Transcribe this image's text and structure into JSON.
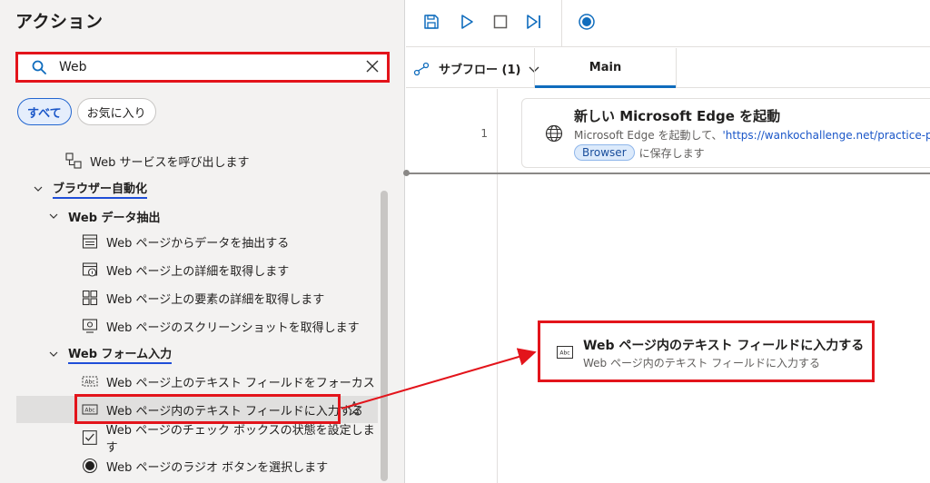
{
  "actions_pane": {
    "title": "アクション",
    "search": {
      "value": "Web"
    },
    "filters": {
      "all": "すべて",
      "favorites": "お気に入り"
    },
    "tree": {
      "web_service": "Web サービスを呼び出します",
      "browser_automation": "ブラウザー自動化",
      "web_data_extraction": "Web データ抽出",
      "extract_data": "Web ページからデータを抽出する",
      "get_details": "Web ページ上の詳細を取得します",
      "get_element_details": "Web ページ上の要素の詳細を取得します",
      "take_screenshot": "Web ページのスクリーンショットを取得します",
      "web_form_filling": "Web フォーム入力",
      "focus_text_field": "Web ページ上のテキスト フィールドをフォーカス",
      "populate_text_field": "Web ページ内のテキスト フィールドに入力する",
      "set_checkbox": "Web ページのチェック ボックスの状態を設定します",
      "select_radio": "Web ページのラジオ ボタンを選択します"
    }
  },
  "tabs": {
    "subflow_label": "サブフロー (1)",
    "main_tab": "Main"
  },
  "flow": {
    "steps": [
      {
        "line": "1",
        "title": "新しい Microsoft Edge を起動",
        "desc_prefix": "Microsoft Edge を起動して、",
        "desc_link": "'https://wankochallenge.net/practice-pa",
        "variable": "Browser",
        "save_suffix": "に保存します"
      }
    ],
    "drag_card": {
      "title": "Web ページ内のテキスト フィールドに入力する",
      "subtitle": "Web ページ内のテキスト フィールドに入力する",
      "icon_text": "Abc"
    }
  },
  "colors": {
    "highlight_red": "#e3141b",
    "accent_blue": "#0f6cbd",
    "underline_blue": "#1f4ed8"
  }
}
